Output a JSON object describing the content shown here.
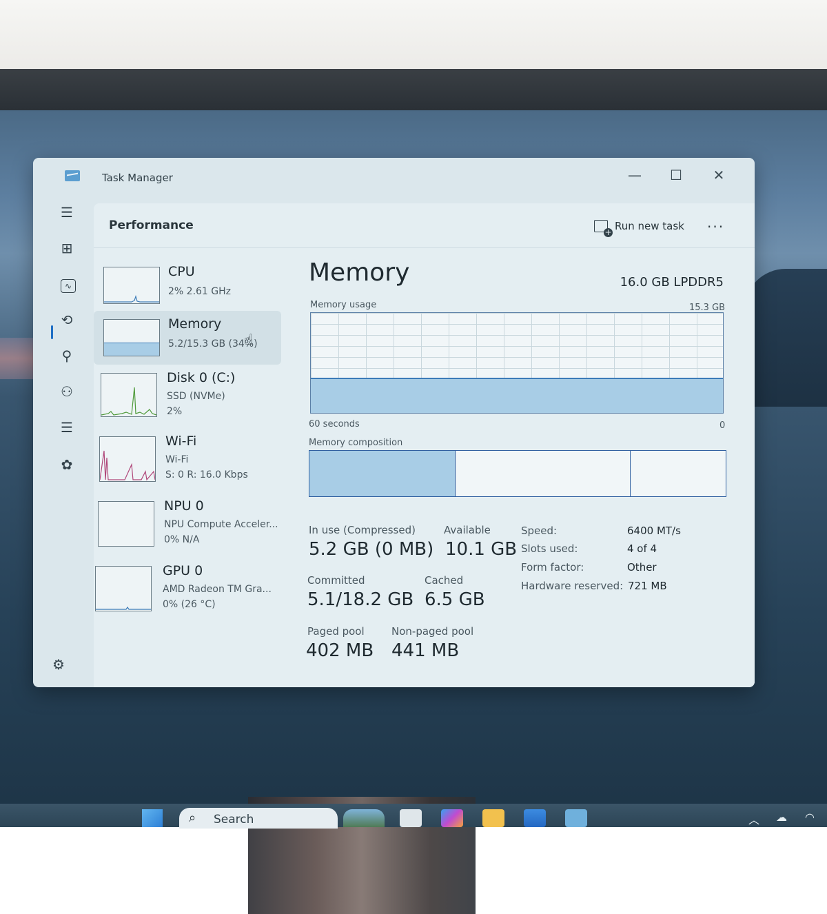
{
  "window": {
    "title": "Task Manager",
    "controls": [
      "—",
      "☐",
      "✕"
    ]
  },
  "nav": {
    "icons": [
      "hamburger-icon",
      "processes-icon",
      "performance-icon",
      "app-history-icon",
      "startup-apps-icon",
      "users-icon",
      "details-icon",
      "services-icon",
      "settings-icon"
    ]
  },
  "header": {
    "title": "Performance",
    "run_new_task": "Run new task",
    "more": "···"
  },
  "resources": [
    {
      "name": "CPU",
      "line1": "2%  2.61 GHz",
      "line2": ""
    },
    {
      "name": "Memory",
      "line1": "5.2/15.3 GB (34%)",
      "line2": ""
    },
    {
      "name": "Disk 0 (C:)",
      "line1": "SSD (NVMe)",
      "line2": "2%"
    },
    {
      "name": "Wi-Fi",
      "line1": "Wi-Fi",
      "line2": "S: 0 R: 16.0 Kbps"
    },
    {
      "name": "NPU 0",
      "line1": "NPU Compute Acceler...",
      "line2": "0%  N/A"
    },
    {
      "name": "GPU 0",
      "line1": "AMD Radeon TM Gra...",
      "line2": "0%  (26 °C)"
    }
  ],
  "memory": {
    "title": "Memory",
    "spec": "16.0 GB LPDDR5",
    "usage_label": "Memory usage",
    "usage_max": "15.3 GB",
    "usage_fraction": 0.34,
    "x_left": "60 seconds",
    "x_right": "0",
    "composition_label": "Memory composition",
    "composition": {
      "in_use": 0.34,
      "modified": 0.01,
      "standby": 0.42
    },
    "stats": {
      "in_use_label": "In use (Compressed)",
      "in_use_value": "5.2 GB (0 MB)",
      "available_label": "Available",
      "available_value": "10.1 GB",
      "committed_label": "Committed",
      "committed_value": "5.1/18.2 GB",
      "cached_label": "Cached",
      "cached_value": "6.5 GB",
      "paged_label": "Paged pool",
      "paged_value": "402 MB",
      "nonpaged_label": "Non-paged pool",
      "nonpaged_value": "441 MB"
    },
    "info": {
      "speed_label": "Speed:",
      "speed_value": "6400 MT/s",
      "slots_label": "Slots used:",
      "slots_value": "4 of 4",
      "form_label": "Form factor:",
      "form_value": "Other",
      "reserved_label": "Hardware reserved:",
      "reserved_value": "721 MB"
    }
  },
  "taskbar": {
    "search_placeholder": "Search"
  },
  "colors": {
    "accent": "#1f6fc5",
    "memory_fill": "#a8cde6",
    "memory_line": "#3b7bb8",
    "cpu_line": "#3b7bb8",
    "disk_line": "#4f9a3a",
    "wifi_line": "#b0487a"
  }
}
